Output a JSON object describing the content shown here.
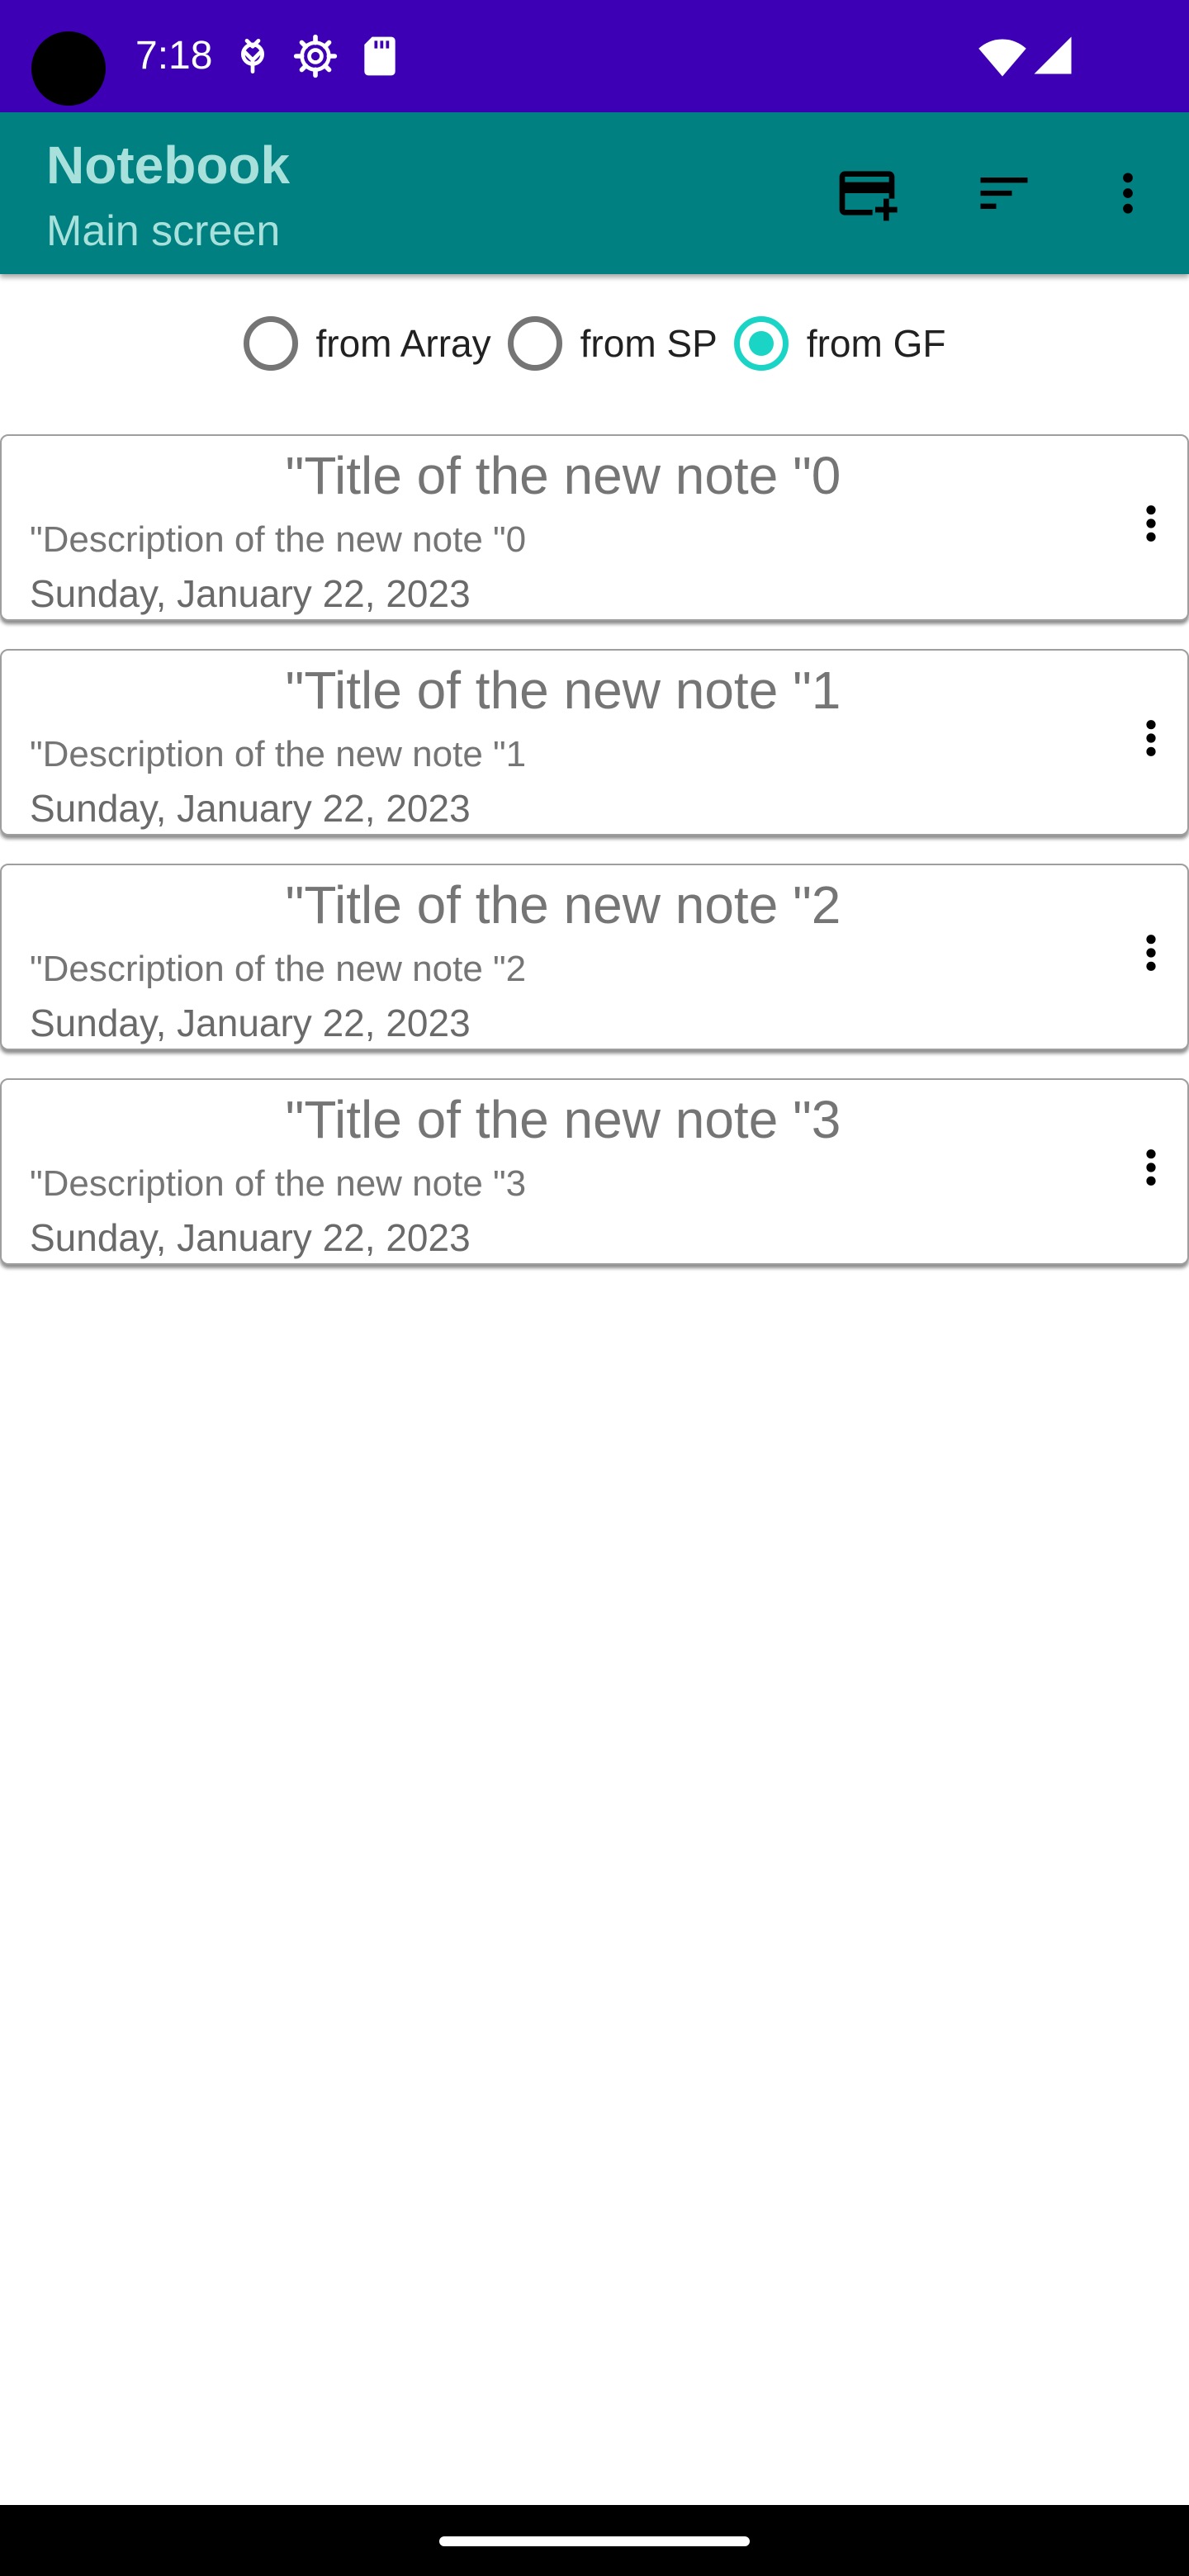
{
  "status_bar": {
    "time": "7:18",
    "icons": [
      "android-debug-icon",
      "settings-gear-icon",
      "sd-card-icon",
      "wifi-icon",
      "signal-icon"
    ],
    "background": "#3d00b5"
  },
  "app_bar": {
    "title": "Notebook",
    "subtitle": "Main screen",
    "background": "#008080",
    "actions": [
      "add-note-icon",
      "sort-icon",
      "more-vert-icon"
    ]
  },
  "source_selector": {
    "options": [
      {
        "label": "from Array",
        "checked": false
      },
      {
        "label": "from SP",
        "checked": false
      },
      {
        "label": "from GF",
        "checked": true
      }
    ],
    "accent": "#1ad5c5"
  },
  "notes": [
    {
      "title": "\"Title of the new note \"0",
      "description": "\"Description of the new note \"0",
      "date": "Sunday, January 22, 2023"
    },
    {
      "title": "\"Title of the new note \"1",
      "description": "\"Description of the new note \"1",
      "date": "Sunday, January 22, 2023"
    },
    {
      "title": "\"Title of the new note \"2",
      "description": "\"Description of the new note \"2",
      "date": "Sunday, January 22, 2023"
    },
    {
      "title": "\"Title of the new note \"3",
      "description": "\"Description of the new note \"3",
      "date": "Sunday, January 22, 2023"
    }
  ]
}
